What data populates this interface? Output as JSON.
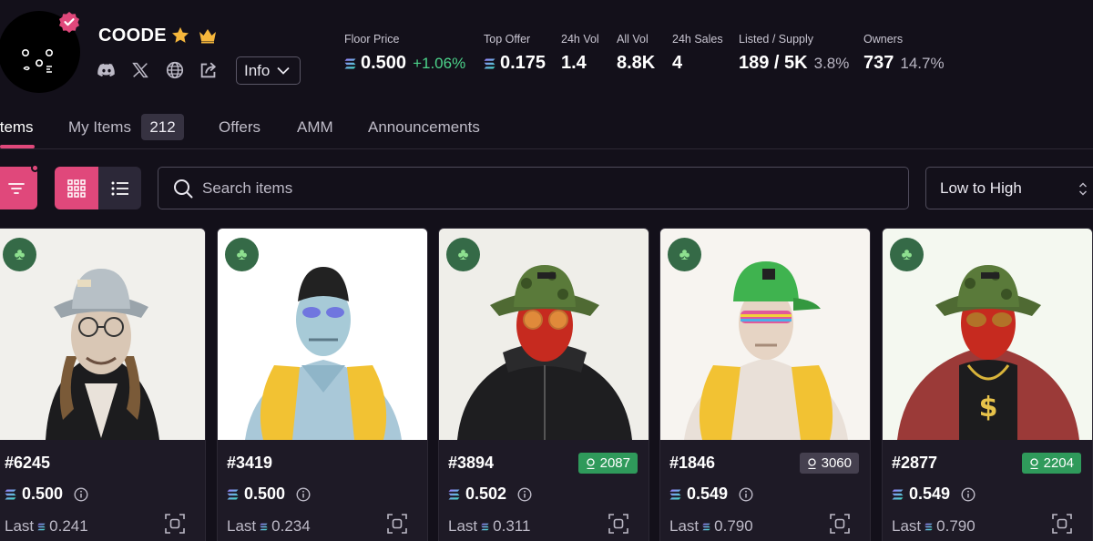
{
  "collection": {
    "name": "COODE",
    "info_label": "Info"
  },
  "stats": [
    {
      "label": "Floor Price",
      "value": "0.500",
      "change": "+1.06%"
    },
    {
      "label": "Top Offer",
      "value": "0.175"
    },
    {
      "label": "24h Vol",
      "value": "1.4"
    },
    {
      "label": "All Vol",
      "value": "8.8K"
    },
    {
      "label": "24h Sales",
      "value": "4"
    },
    {
      "label": "Listed / Supply",
      "value": "189 / 5K",
      "pct": "3.8%"
    },
    {
      "label": "Owners",
      "value": "737",
      "pct": "14.7%"
    }
  ],
  "tabs": [
    {
      "label": "Items"
    },
    {
      "label": "My Items",
      "count": "212"
    },
    {
      "label": "Offers"
    },
    {
      "label": "AMM"
    },
    {
      "label": "Announcements"
    }
  ],
  "search": {
    "placeholder": "Search items"
  },
  "sort": {
    "selected": "Low to High"
  },
  "colors": {
    "accent": "#e0487b",
    "rank_green": "#2f9a5b",
    "rank_gray": "#45404f",
    "background": "#13101a"
  },
  "cards": [
    {
      "id": "#6245",
      "price": "0.500",
      "last_label": "Last",
      "last": "0.241",
      "rank": null
    },
    {
      "id": "#3419",
      "price": "0.500",
      "last_label": "Last",
      "last": "0.234",
      "rank": null
    },
    {
      "id": "#3894",
      "price": "0.502",
      "last_label": "Last",
      "last": "0.311",
      "rank": "2087",
      "rank_style": "green"
    },
    {
      "id": "#1846",
      "price": "0.549",
      "last_label": "Last",
      "last": "0.790",
      "rank": "3060",
      "rank_style": "gray"
    },
    {
      "id": "#2877",
      "price": "0.549",
      "last_label": "Last",
      "last": "0.790",
      "rank": "2204",
      "rank_style": "green"
    }
  ]
}
